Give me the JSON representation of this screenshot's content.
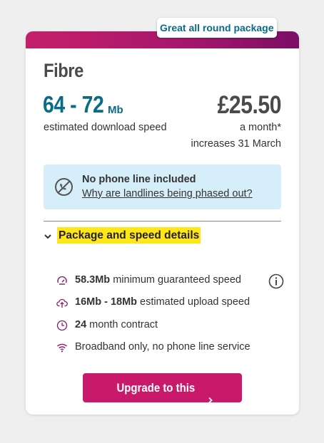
{
  "badge": "Great all round package",
  "plan": {
    "name": "Fibre",
    "speed_range": "64 - 72",
    "speed_unit": "Mb",
    "speed_caption": "estimated download speed",
    "price": "£25.50",
    "price_period": "a month*",
    "price_increase": "increases 31 March"
  },
  "notice": {
    "title": "No phone line included",
    "link": "Why are landlines being phased out?",
    "icon": "no-phone-icon"
  },
  "accordion": {
    "label": "Package and speed details",
    "icon": "chevron-down-icon"
  },
  "features": [
    {
      "icon": "speedometer-icon",
      "bold": "58.3Mb",
      "text": " minimum guaranteed speed"
    },
    {
      "icon": "upload-cloud-icon",
      "bold": "16Mb - 18Mb",
      "text": " estimated upload speed"
    },
    {
      "icon": "clock-icon",
      "bold": "24",
      "text": " month contract"
    },
    {
      "icon": "wifi-icon",
      "bold": "",
      "text": "Broadband only, no phone line service"
    }
  ],
  "cta": {
    "label": "Upgrade to this"
  },
  "colors": {
    "brand_pink": "#c8196a",
    "teal": "#0a6b86",
    "notice_bg": "#d6eef9",
    "highlight": "#ffe614",
    "feature_icon": "#8a1b6b"
  }
}
